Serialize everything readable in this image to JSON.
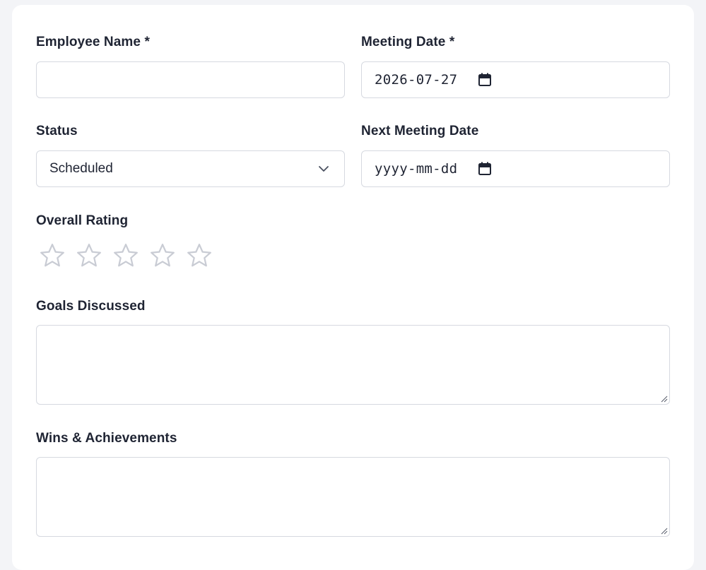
{
  "form": {
    "employee_name": {
      "label": "Employee Name *",
      "value": ""
    },
    "meeting_date": {
      "label": "Meeting Date *",
      "value": "2026-07-27"
    },
    "status": {
      "label": "Status",
      "selected": "Scheduled"
    },
    "next_meeting_date": {
      "label": "Next Meeting Date",
      "placeholder": "yyyy-mm-dd"
    },
    "overall_rating": {
      "label": "Overall Rating",
      "max": 5,
      "value": 0
    },
    "goals_discussed": {
      "label": "Goals Discussed",
      "value": ""
    },
    "wins_achievements": {
      "label": "Wins & Achievements",
      "value": ""
    }
  },
  "icons": {
    "date": "calendar-icon",
    "select": "chevron-down-icon",
    "rating": "star-outline-icon",
    "resize": "resize-handle-icon"
  },
  "colors": {
    "background": "#f3f4f7",
    "card": "#ffffff",
    "border": "#d6d9e0",
    "star_outline": "#c9ccd4",
    "text": "#1f2433"
  }
}
